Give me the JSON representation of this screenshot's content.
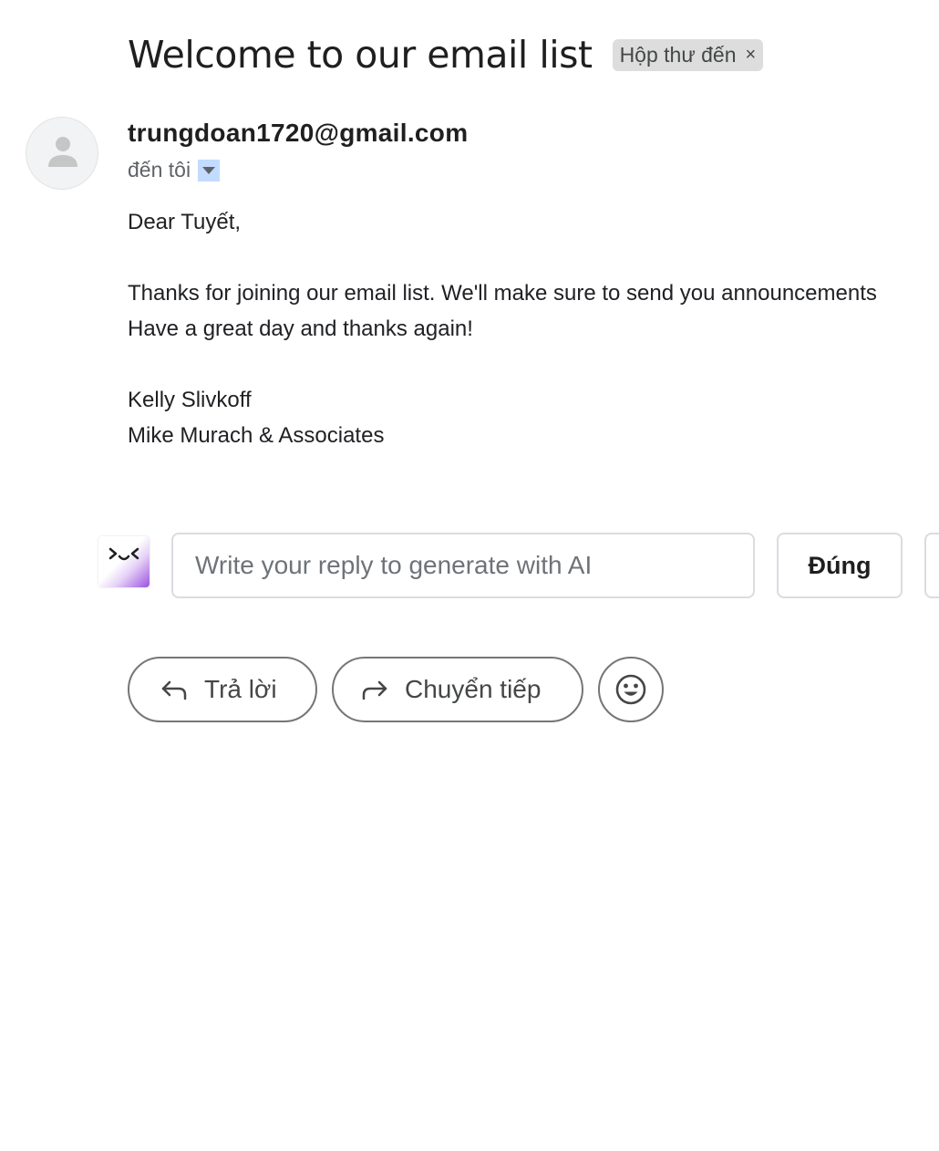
{
  "subject": "Welcome to our email list",
  "label_chip": {
    "text": "Hộp thư đến",
    "close_glyph": "×"
  },
  "sender": {
    "email": "trungdoan1720@gmail.com",
    "avatar_icon": "person-icon"
  },
  "recipient": {
    "text": "đến tôi",
    "toggle_icon": "chevron-down-icon"
  },
  "body": {
    "greeting": "Dear Tuyết,",
    "line1": "Thanks for joining our email list. We'll make sure to send you announcements",
    "line2": "Have a great day and thanks again!",
    "signature_name": "Kelly Slivkoff",
    "signature_company": "Mike Murach & Associates"
  },
  "ai_reply": {
    "logo_icon": "ai-assistant-icon",
    "placeholder": "Write your reply to generate with AI",
    "suggestions": [
      "Đúng",
      ""
    ]
  },
  "actions": {
    "reply_label": "Trả lời",
    "forward_label": "Chuyển tiếp",
    "reply_icon": "reply-arrow-icon",
    "forward_icon": "forward-arrow-icon",
    "emoji_icon": "emoji-icon"
  },
  "colors": {
    "label_chip_bg": "#dddddd",
    "toggle_bg": "#c2dbff",
    "ai_logo_accent": "#9b51e0",
    "pill_border": "#747775"
  }
}
